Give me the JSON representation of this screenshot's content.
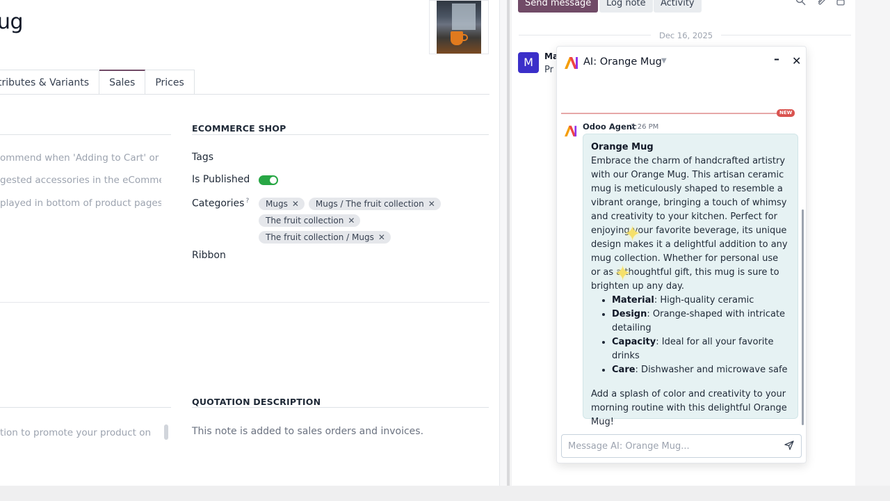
{
  "product": {
    "title": "ug",
    "tabs": [
      {
        "label": "tributes & Variants"
      },
      {
        "label": "Sales"
      },
      {
        "label": "Prices"
      }
    ]
  },
  "sales_tab": {
    "left_help": [
      "ommend when 'Adding to Cart' or q...",
      "gested accessories in the eCommer...",
      "played in bottom of product pages",
      "tion to promote your product on"
    ],
    "ecommerce_section": "ECOMMERCE SHOP",
    "tags_label": "Tags",
    "published_label": "Is Published",
    "is_published": true,
    "categories_label": "Categories",
    "categories_help": "?",
    "categories": [
      "Mugs",
      "Mugs / The fruit collection",
      "The fruit collection",
      "The fruit collection / Mugs"
    ],
    "ribbon_label": "Ribbon",
    "quotation_section": "QUOTATION DESCRIPTION",
    "quotation_note": "This note is added to sales orders and invoices."
  },
  "chatter": {
    "send_message": "Send message",
    "log_note": "Log note",
    "activity": "Activity",
    "date": "Dec 16, 2025",
    "avatar_letter": "M",
    "msg_author_clip": "Ma",
    "msg_text_clip": "Pr",
    "icons": [
      "search-icon",
      "paperclip-icon",
      "lock-icon"
    ]
  },
  "ai_chat": {
    "title": "AI: Orange Mug",
    "new_badge": "NEW",
    "agent_name": "Odoo Agent",
    "time": "2:26 PM",
    "message": {
      "title": "Orange Mug",
      "body": "Embrace the charm of handcrafted artistry with our Orange Mug. This artisan ceramic mug is meticulously shaped to resemble a vibrant orange, bringing a touch of whimsy and creativity to your kitchen. Perfect for enjoying your favorite beverage, its unique design makes it a delightful addition to any mug collection. Whether for personal use or as a thoughtful gift, this mug is sure to brighten up any day.",
      "bullets": [
        {
          "key": "Material",
          "value": ": High-quality ceramic"
        },
        {
          "key": "Design",
          "value": ": Orange-shaped with intricate detailing"
        },
        {
          "key": "Capacity",
          "value": ": Ideal for all your favorite drinks"
        },
        {
          "key": "Care",
          "value": ": Dishwasher and microwave safe"
        }
      ],
      "closing": "Add a splash of color and creativity to your morning routine with this delightful Orange Mug!"
    },
    "input_placeholder": "Message AI: Orange Mug...",
    "input_value": ""
  },
  "colors": {
    "brand": "#714b67",
    "toggle_on": "#28a745",
    "avatar": "#3b2fc9",
    "bubble_bg": "#e6f2f3",
    "new_badge": "#d9534f"
  }
}
